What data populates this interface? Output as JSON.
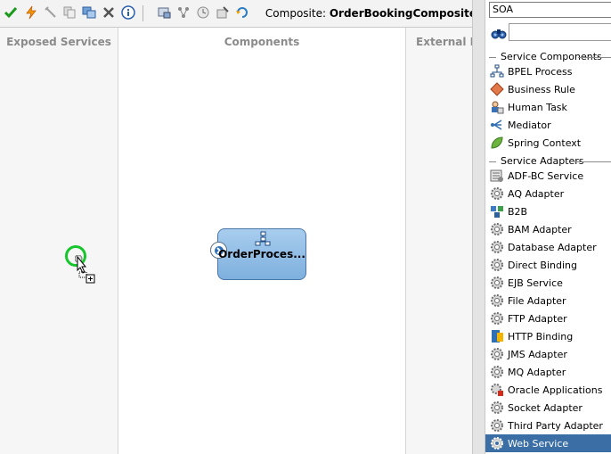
{
  "toolbar": {
    "icons": [
      "validate-check-icon",
      "lightning-icon",
      "pin-icon",
      "copy-icon",
      "duplicate-icon",
      "delete-x-icon",
      "info-icon",
      "deploy-icon",
      "layout-icon",
      "clock-icon",
      "edit-icon",
      "undo-icon"
    ],
    "composite_label": "Composite:",
    "composite_name": "OrderBookingComposite"
  },
  "swimlanes": {
    "exposed": "Exposed Services",
    "components": "Components",
    "external": "External R"
  },
  "component": {
    "name": "OrderProces..."
  },
  "palette": {
    "category": "SOA",
    "sections": {
      "service_components": "Service Components",
      "service_adapters": "Service Adapters"
    },
    "service_components": [
      {
        "label": "BPEL Process",
        "icon": "bpel-process-icon"
      },
      {
        "label": "Business Rule",
        "icon": "business-rule-icon"
      },
      {
        "label": "Human Task",
        "icon": "human-task-icon"
      },
      {
        "label": "Mediator",
        "icon": "mediator-icon"
      },
      {
        "label": "Spring Context",
        "icon": "spring-context-icon"
      }
    ],
    "service_adapters": [
      {
        "label": "ADF-BC Service",
        "icon": "adf-bc-icon"
      },
      {
        "label": "AQ Adapter",
        "icon": "gear-icon"
      },
      {
        "label": "B2B",
        "icon": "b2b-icon"
      },
      {
        "label": "BAM Adapter",
        "icon": "gear-icon"
      },
      {
        "label": "Database Adapter",
        "icon": "gear-icon"
      },
      {
        "label": "Direct Binding",
        "icon": "gear-icon"
      },
      {
        "label": "EJB Service",
        "icon": "gear-icon"
      },
      {
        "label": "File Adapter",
        "icon": "gear-icon"
      },
      {
        "label": "FTP Adapter",
        "icon": "gear-icon"
      },
      {
        "label": "HTTP Binding",
        "icon": "http-binding-icon"
      },
      {
        "label": "JMS Adapter",
        "icon": "gear-icon"
      },
      {
        "label": "MQ Adapter",
        "icon": "gear-icon"
      },
      {
        "label": "Oracle Applications",
        "icon": "oracle-apps-icon"
      },
      {
        "label": "Socket Adapter",
        "icon": "gear-icon"
      },
      {
        "label": "Third Party Adapter",
        "icon": "gear-icon"
      },
      {
        "label": "Web Service",
        "icon": "web-service-icon",
        "selected": true
      }
    ]
  }
}
